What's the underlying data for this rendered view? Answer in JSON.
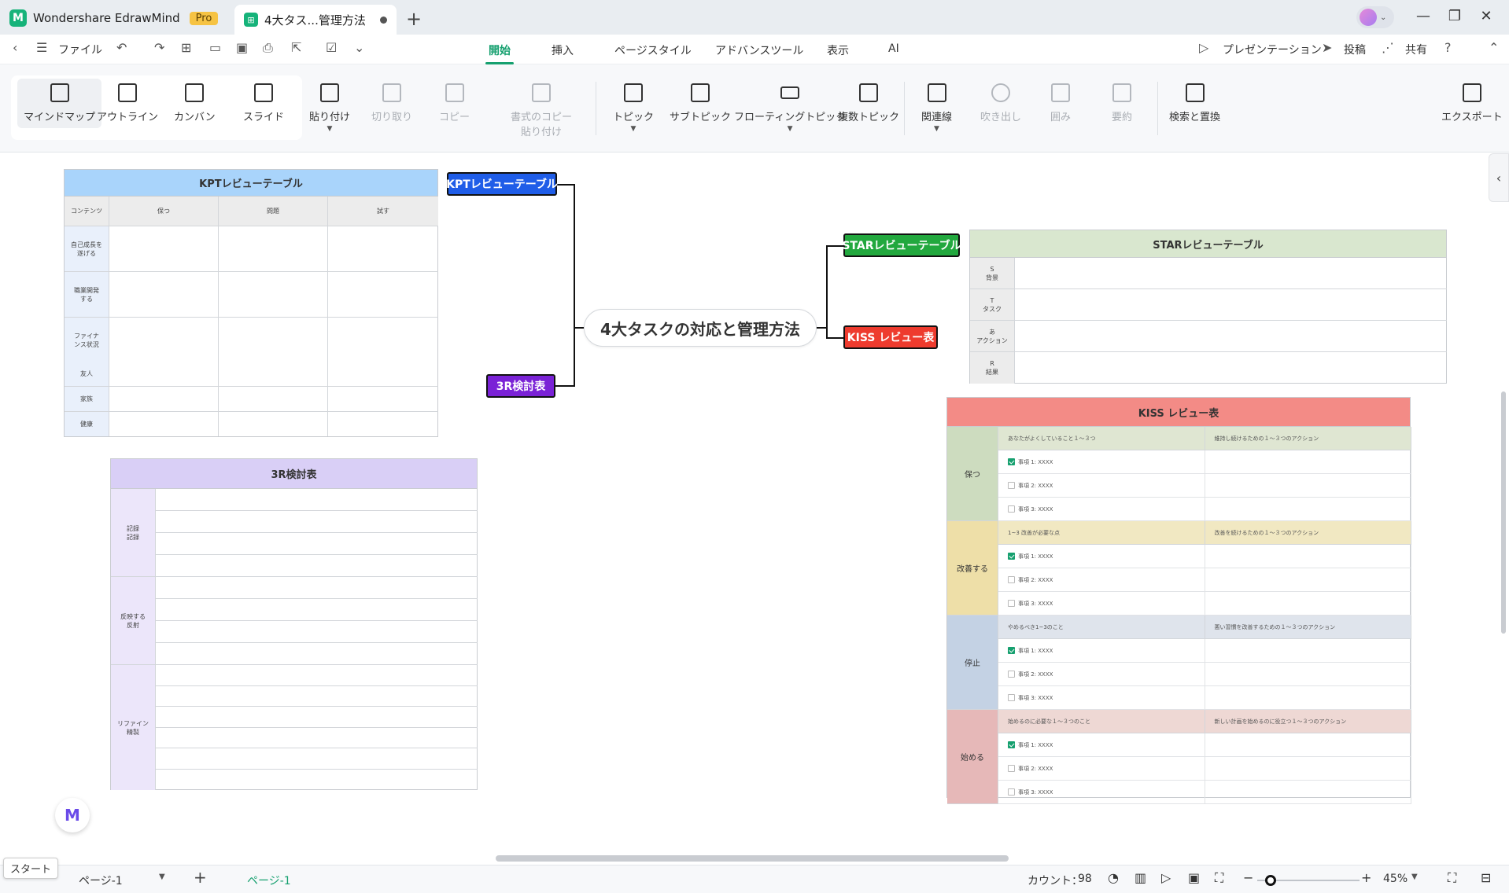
{
  "titlebar": {
    "app_name": "Wondershare EdrawMind",
    "pro_label": "Pro",
    "doc_tab": "4大タス...管理方法",
    "new_tab": "+"
  },
  "menubar": {
    "file_label": "ファイル",
    "tabs": [
      "開始",
      "挿入",
      "ページスタイル",
      "アドバンスツール",
      "表示",
      "AI"
    ],
    "active_tab": "開始",
    "presentation": "プレゼンテーション",
    "post": "投稿",
    "share": "共有"
  },
  "ribbon": {
    "views": [
      "マインドマップ",
      "アウトライン",
      "カンバン",
      "スライド"
    ],
    "paste": "貼り付け",
    "cut": "切り取り",
    "copy": "コピー",
    "format_copy_1": "書式のコピー",
    "format_copy_2": "貼り付け",
    "topic": "トピック",
    "subtopic": "サブトピック",
    "floating_topic": "フローティングトピック",
    "multi_topic": "複数トピック",
    "relation": "関連線",
    "callout": "吹き出し",
    "boundary": "囲み",
    "summary": "要約",
    "find_replace": "検索と置換",
    "export": "エクスポート"
  },
  "mindmap": {
    "central": "4大タスクの対応と管理方法",
    "topics": {
      "kpt": "KPTレビューテーブル",
      "r3": "3R検討表",
      "star": "STARレビューテーブル",
      "kiss": "KISS レビュー表"
    },
    "colors": {
      "kpt_topic": "#1f5de8",
      "r3_topic": "#7a22d6",
      "star_topic": "#22a83e",
      "kiss_topic": "#ee3b2e"
    },
    "kpt_table": {
      "title": "KPTレビューテーブル",
      "col_headers": [
        "コンテンツ",
        "保つ",
        "問題",
        "試す"
      ],
      "rows": [
        "自己成長を遂げる",
        "職業開発する",
        "ファイナンス状況",
        "友人",
        "家族",
        "健康"
      ]
    },
    "r3_table": {
      "title": "3R検討表",
      "rows": [
        "記録\n記録",
        "反映する\n反射",
        "リファイン\n精製"
      ]
    },
    "star_table": {
      "title": "STARレビューテーブル",
      "rows": [
        "S\n背景",
        "T\nタスク",
        "あ\nアクション",
        "R\n結果"
      ]
    },
    "kiss_table": {
      "title": "KISS レビュー表",
      "sections": [
        {
          "name": "保つ",
          "left": "あなたがよくしていること１～３つ",
          "right": "維持し続けるための１～３つのアクション",
          "color": "#cddcbf",
          "sub_color": "#dfe6d2"
        },
        {
          "name": "改善する",
          "left": "1~3 改善が必要な点",
          "right": "改善を続けるための１～３つのアクション",
          "color": "#eedfa8",
          "sub_color": "#f1e8c2"
        },
        {
          "name": "停止",
          "left": "やめるべき1~3のこと",
          "right": "悪い習慣を改善するための１～３つのアクション",
          "color": "#c4d2e4",
          "sub_color": "#dfe4ec"
        },
        {
          "name": "始める",
          "left": "始めるのに必要な１～３つのこと",
          "right": "新しい計画を始めるのに役立つ１～３つのアクション",
          "color": "#e6b8b8",
          "sub_color": "#eed8d4"
        }
      ],
      "items": [
        "事項 1: XXXX",
        "事項 2: XXXX",
        "事項 3: XXXX"
      ]
    }
  },
  "statusbar": {
    "start_tooltip": "スタート",
    "page_select": "ページ-1",
    "page_tab": "ページ-1",
    "count_label": "カウント：",
    "count_value": "98",
    "zoom": "45%"
  }
}
